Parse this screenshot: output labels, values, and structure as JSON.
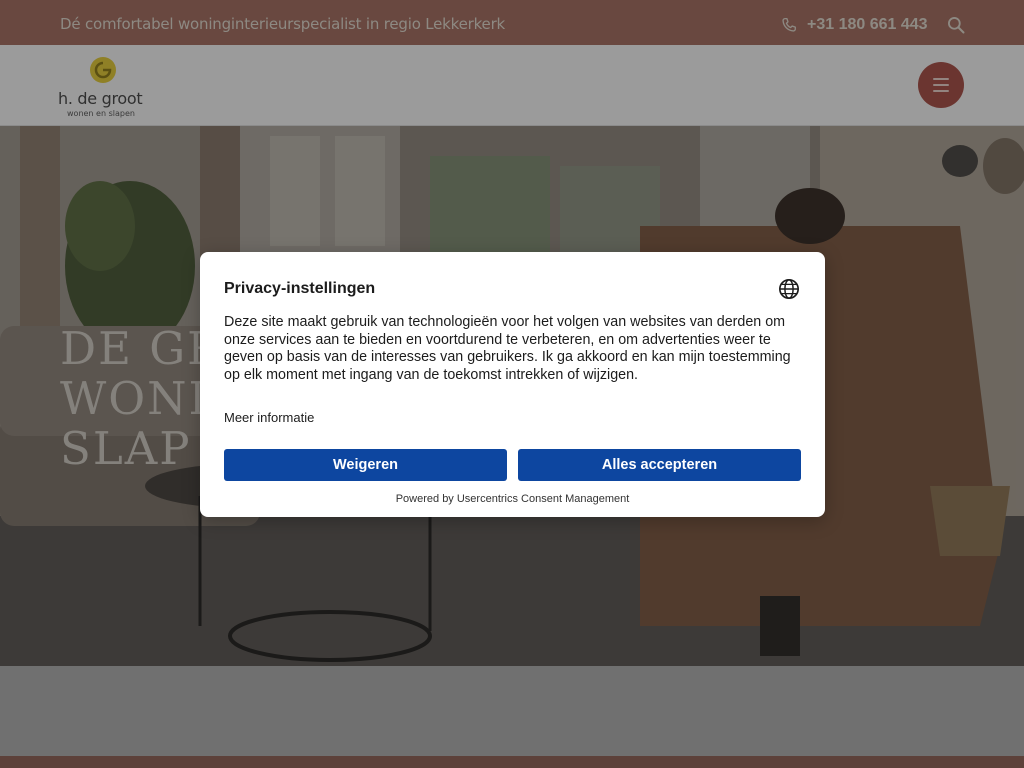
{
  "topbar": {
    "tagline": "Dé comfortabel woninginterieurspecialist in regio Lekkerkerk",
    "phone": "+31 180 661 443",
    "icons": {
      "phone": "phone-icon",
      "search": "search-icon"
    }
  },
  "header": {
    "logo": {
      "name": "h. de groot",
      "tagline": "wonen en slapen"
    },
    "menu_icon": "hamburger-icon"
  },
  "hero": {
    "title_lines": [
      "DE GR",
      "WONI",
      "SLAP"
    ]
  },
  "consent": {
    "title": "Privacy-instellingen",
    "language_icon": "globe-icon",
    "body": "Deze site maakt gebruik van technologieën voor het volgen van websites van derden om onze services aan te bieden en voortdurend te verbeteren, en om advertenties weer te geven op basis van de interesses van gebruikers. Ik ga akkoord en kan mijn toestemming op elk moment met ingang van de toekomst intrekken of wijzigen.",
    "more_info": "Meer informatie",
    "deny_label": "Weigeren",
    "accept_label": "Alles accepteren",
    "powered_by": "Powered by Usercentrics Consent Management"
  },
  "colors": {
    "topbar_bg": "#a06e62",
    "menu_button": "#a3514a",
    "primary_button": "#0d46a0",
    "logo_yellow": "#d9c23a"
  }
}
